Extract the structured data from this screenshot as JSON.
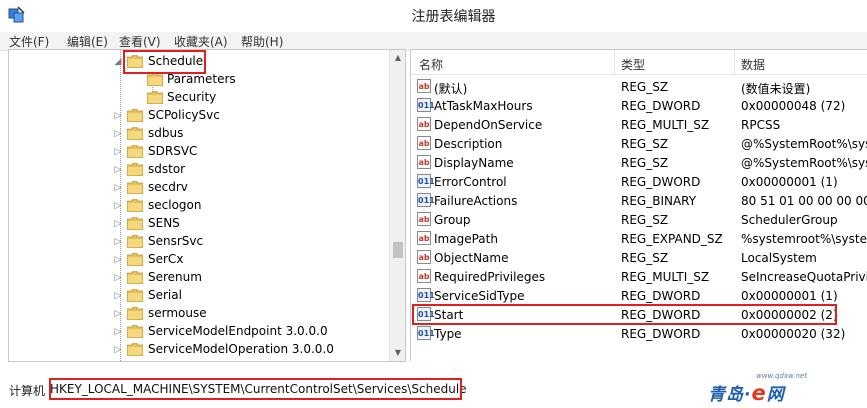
{
  "window": {
    "title": "注册表编辑器"
  },
  "menu": [
    {
      "label": "文件(F)"
    },
    {
      "label": "编辑(E)"
    },
    {
      "label": "查看(V)"
    },
    {
      "label": "收藏夹(A)"
    },
    {
      "label": "帮助(H)"
    }
  ],
  "tree": {
    "items": [
      {
        "label": "Schedule",
        "expander": "expanded"
      },
      {
        "label": "Parameters",
        "expander": "none"
      },
      {
        "label": "Security",
        "expander": "none"
      },
      {
        "label": "SCPolicySvc",
        "expander": "collapsed"
      },
      {
        "label": "sdbus",
        "expander": "collapsed"
      },
      {
        "label": "SDRSVC",
        "expander": "collapsed"
      },
      {
        "label": "sdstor",
        "expander": "collapsed"
      },
      {
        "label": "secdrv",
        "expander": "collapsed"
      },
      {
        "label": "seclogon",
        "expander": "collapsed"
      },
      {
        "label": "SENS",
        "expander": "collapsed"
      },
      {
        "label": "SensrSvc",
        "expander": "collapsed"
      },
      {
        "label": "SerCx",
        "expander": "collapsed"
      },
      {
        "label": "Serenum",
        "expander": "collapsed"
      },
      {
        "label": "Serial",
        "expander": "collapsed"
      },
      {
        "label": "sermouse",
        "expander": "collapsed"
      },
      {
        "label": "ServiceModelEndpoint 3.0.0.0",
        "expander": "collapsed"
      },
      {
        "label": "ServiceModelOperation 3.0.0.0",
        "expander": "collapsed"
      }
    ]
  },
  "list": {
    "columns": {
      "name": "名称",
      "type": "类型",
      "data": "数据"
    },
    "rows": [
      {
        "icon": "string-value-icon",
        "name": "(默认)",
        "type": "REG_SZ",
        "data": "(数值未设置)"
      },
      {
        "icon": "binary-value-icon",
        "name": "AtTaskMaxHours",
        "type": "REG_DWORD",
        "data": "0x00000048 (72)"
      },
      {
        "icon": "string-value-icon",
        "name": "DependOnService",
        "type": "REG_MULTI_SZ",
        "data": "RPCSS"
      },
      {
        "icon": "string-value-icon",
        "name": "Description",
        "type": "REG_SZ",
        "data": "@%SystemRoot%\\syst"
      },
      {
        "icon": "string-value-icon",
        "name": "DisplayName",
        "type": "REG_SZ",
        "data": "@%SystemRoot%\\syst"
      },
      {
        "icon": "binary-value-icon",
        "name": "ErrorControl",
        "type": "REG_DWORD",
        "data": "0x00000001 (1)"
      },
      {
        "icon": "binary-value-icon",
        "name": "FailureActions",
        "type": "REG_BINARY",
        "data": "80 51 01 00 00 00 00 0"
      },
      {
        "icon": "string-value-icon",
        "name": "Group",
        "type": "REG_SZ",
        "data": "SchedulerGroup"
      },
      {
        "icon": "string-value-icon",
        "name": "ImagePath",
        "type": "REG_EXPAND_SZ",
        "data": "%systemroot%\\system"
      },
      {
        "icon": "string-value-icon",
        "name": "ObjectName",
        "type": "REG_SZ",
        "data": "LocalSystem"
      },
      {
        "icon": "string-value-icon",
        "name": "RequiredPrivileges",
        "type": "REG_MULTI_SZ",
        "data": "SeIncreaseQuotaPrivil"
      },
      {
        "icon": "binary-value-icon",
        "name": "ServiceSidType",
        "type": "REG_DWORD",
        "data": "0x00000001 (1)"
      },
      {
        "icon": "binary-value-icon",
        "name": "Start",
        "type": "REG_DWORD",
        "data": "0x00000002 (2)"
      },
      {
        "icon": "binary-value-icon",
        "name": "Type",
        "type": "REG_DWORD",
        "data": "0x00000020 (32)"
      }
    ]
  },
  "status": {
    "prefix": "计算机",
    "path": "HKEY_LOCAL_MACHINE\\SYSTEM\\CurrentControlSet\\Services\\Schedule"
  },
  "watermark": {
    "url": "www.qdxw.net",
    "text_before": "青岛·",
    "text_e": "e",
    "text_after": "网"
  },
  "colors": {
    "highlight": "#e02020",
    "folder": "#e8c15a"
  }
}
